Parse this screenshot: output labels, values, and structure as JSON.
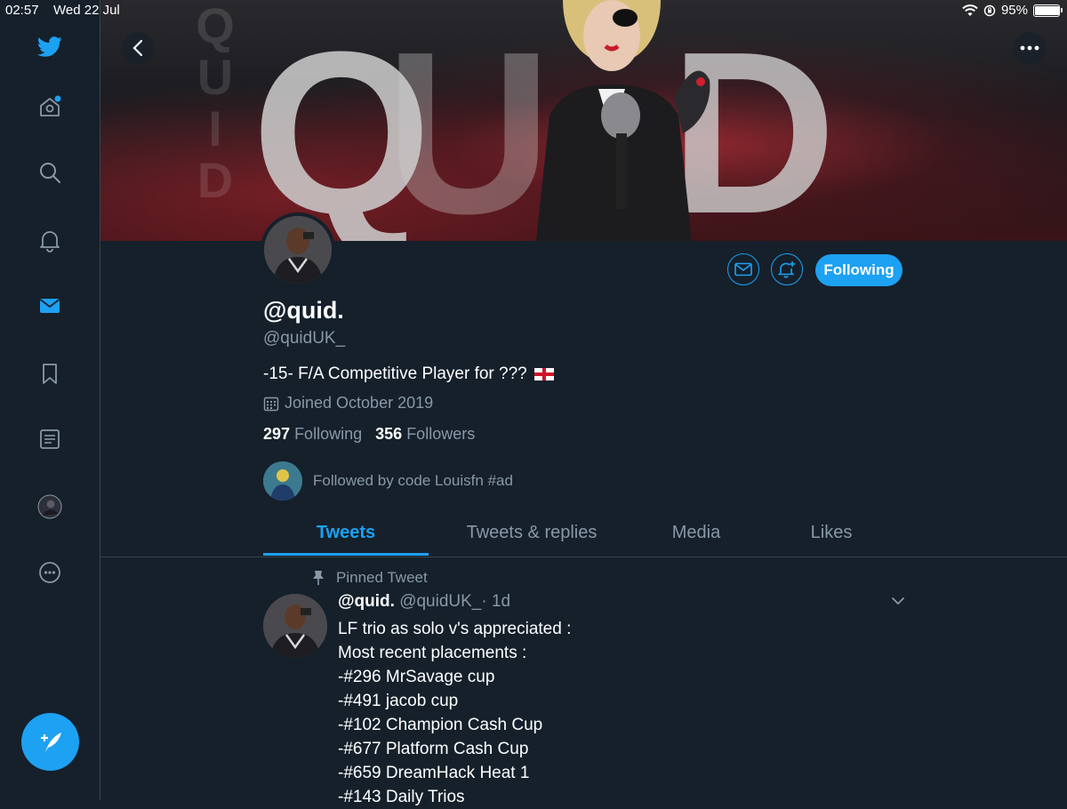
{
  "status_bar": {
    "time": "02:57",
    "date": "Wed 22 Jul",
    "battery": "95%",
    "battery_level": 0.95
  },
  "sidebar": {
    "items": [
      {
        "icon": "twitter-logo-icon"
      },
      {
        "icon": "home-icon",
        "has_badge": true
      },
      {
        "icon": "search-icon"
      },
      {
        "icon": "notifications-bell-icon"
      },
      {
        "icon": "messages-mail-icon",
        "active": true
      },
      {
        "icon": "bookmarks-icon"
      },
      {
        "icon": "lists-icon"
      },
      {
        "icon": "profile-avatar-icon"
      },
      {
        "icon": "more-icon"
      }
    ],
    "compose_icon": "compose-tweet-icon"
  },
  "banner": {
    "text": "QUID",
    "watermark": "QUID"
  },
  "profile": {
    "display_name": "@quid.",
    "handle": "@quidUK_",
    "bio": "-15- F/A Competitive Player for ???",
    "joined": "Joined October 2019",
    "following_count": "297",
    "following_label": "Following",
    "followers_count": "356",
    "followers_label": "Followers",
    "followed_by": "Followed by code Louisfn #ad",
    "follow_button": "Following"
  },
  "tabs": [
    {
      "label": "Tweets",
      "active": true
    },
    {
      "label": "Tweets & replies"
    },
    {
      "label": "Media"
    },
    {
      "label": "Likes"
    }
  ],
  "pinned_tweet": {
    "pinned_label": "Pinned Tweet",
    "author": "@quid.",
    "handle": "@quidUK_",
    "time": "· 1d",
    "lines": [
      "LF trio as solo v's appreciated :",
      "Most recent placements :",
      "-#296 MrSavage cup",
      "-#491 jacob cup",
      "-#102 Champion Cash Cup",
      "-#677 Platform Cash Cup",
      "-#659 DreamHack Heat 1",
      "-#143 Daily Trios"
    ]
  },
  "colors": {
    "background": "#15202b",
    "accent": "#1da1f2",
    "muted": "#8899a6",
    "divider": "#38444d"
  }
}
